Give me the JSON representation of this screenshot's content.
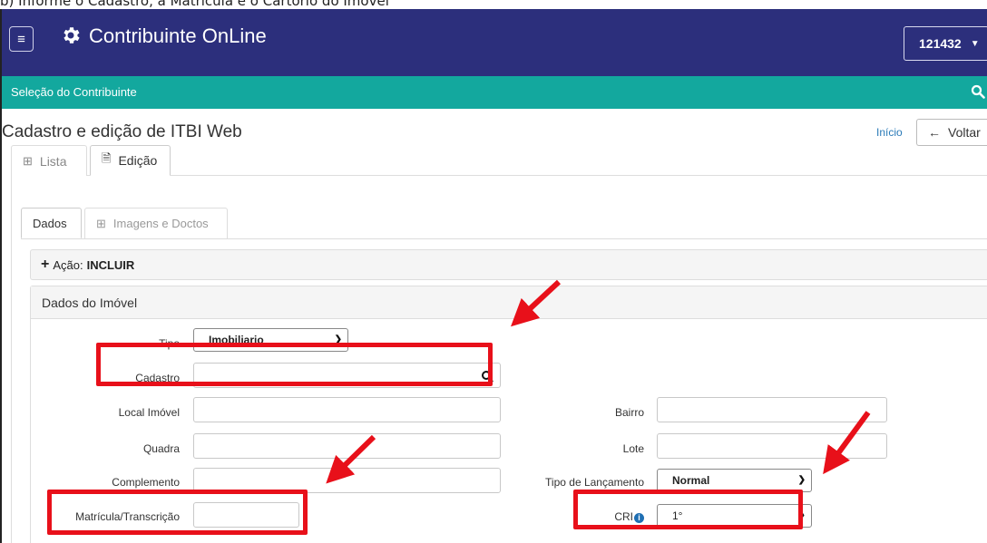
{
  "caption": "b) Informe o Cadastro, a Matrícula e o Cartório do Imóvel",
  "header": {
    "app_title": "Contribuinte OnLine",
    "user_selector": "121432"
  },
  "subheader": {
    "label": "Seleção do Contribuinte"
  },
  "page": {
    "title": "Cadastro e edição de ITBI Web",
    "breadcrumb_home": "Início",
    "back_button": "Voltar"
  },
  "tabs": {
    "lista": "Lista",
    "edicao": "Edição"
  },
  "subtabs": {
    "dados": "Dados",
    "imagens": "Imagens e Doctos"
  },
  "acao": {
    "label": "Ação:",
    "value": "INCLUIR"
  },
  "form": {
    "section_title": "Dados do Imóvel",
    "tipo": {
      "label": "Tipo",
      "value": "Imobiliario"
    },
    "cadastro": {
      "label": "Cadastro",
      "value": ""
    },
    "local_imovel": {
      "label": "Local Imóvel",
      "value": ""
    },
    "bairro": {
      "label": "Bairro",
      "value": ""
    },
    "quadra": {
      "label": "Quadra",
      "value": ""
    },
    "lote": {
      "label": "Lote",
      "value": ""
    },
    "complemento": {
      "label": "Complemento",
      "value": ""
    },
    "tipo_lancamento": {
      "label": "Tipo de Lançamento",
      "value": "Normal"
    },
    "matricula": {
      "label": "Matrícula/Transcrição",
      "value": ""
    },
    "cri": {
      "label": "CRI",
      "value": "1°"
    }
  },
  "colors": {
    "navbar": "#2c2f7c",
    "teal": "#13a89e",
    "highlight": "#e8101a"
  }
}
